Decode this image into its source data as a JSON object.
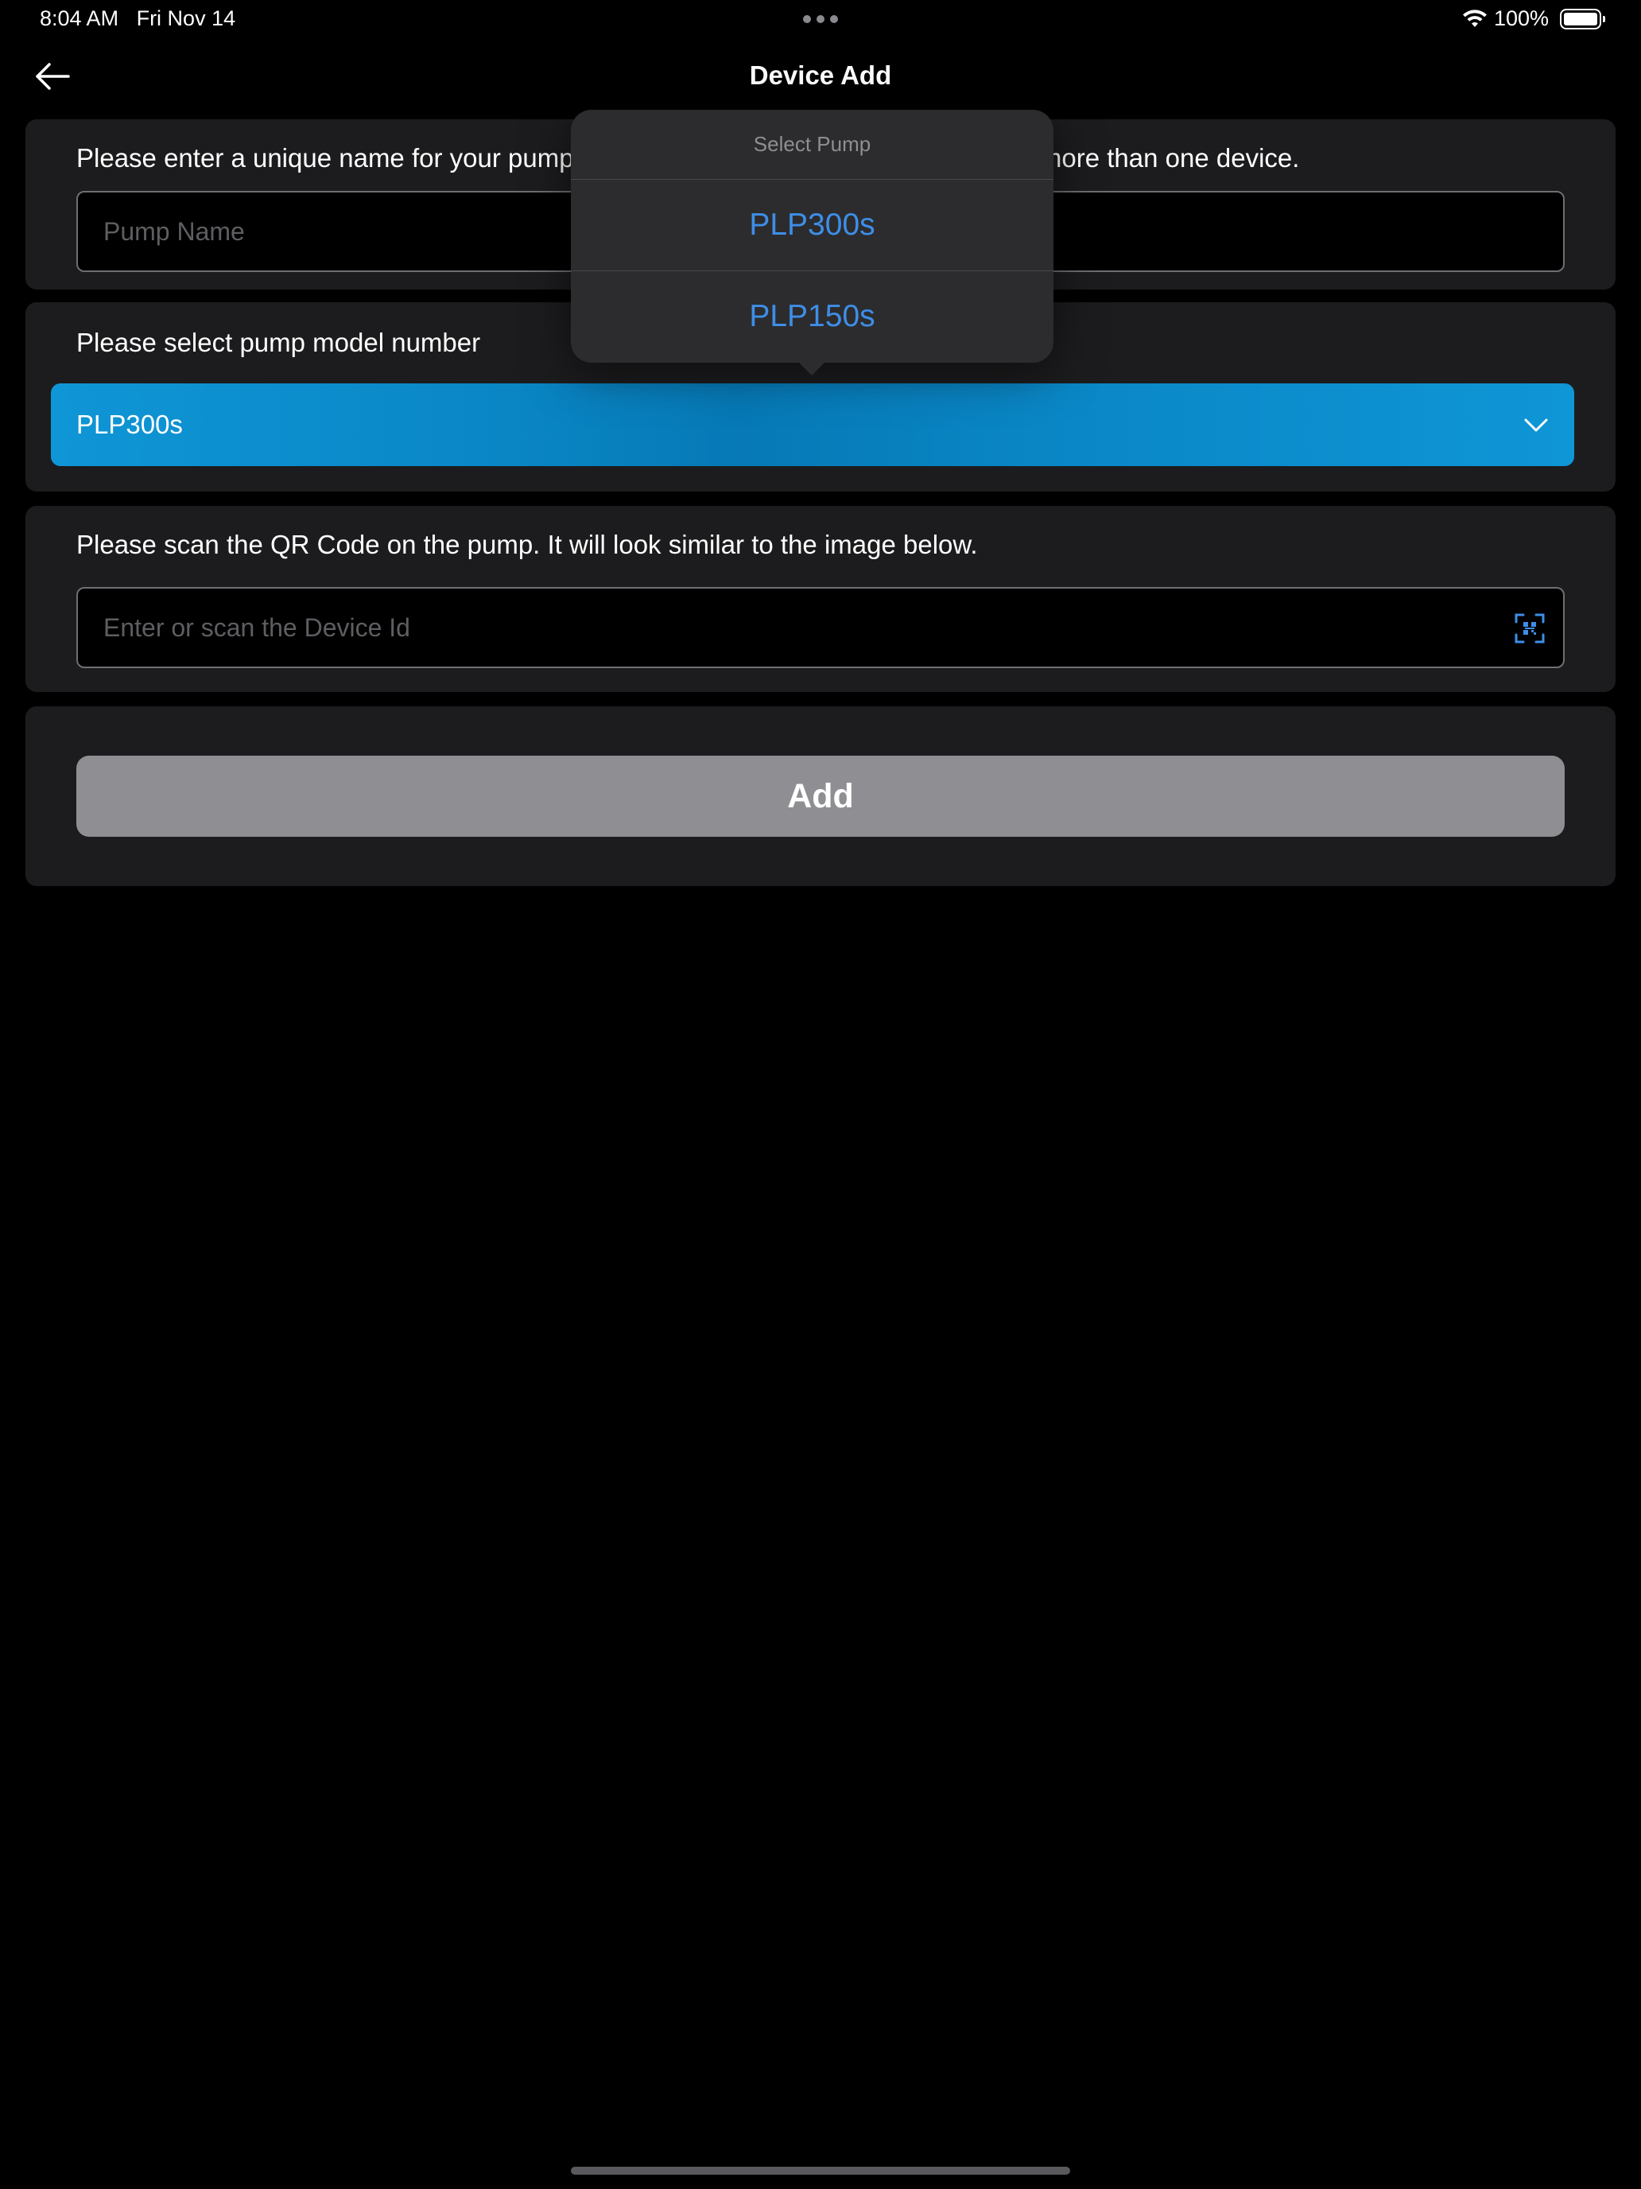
{
  "status_bar": {
    "time": "8:04 AM",
    "date": "Fri Nov 14",
    "battery": "100%",
    "icons": [
      "wifi-icon",
      "battery-icon",
      "more-dots-icon"
    ]
  },
  "nav": {
    "title": "Device Add",
    "back_icon": "arrow-left-icon"
  },
  "name_section": {
    "label": "Please enter a unique name for your pump. This will help you identify it if you have more than one device.",
    "placeholder": "Pump Name",
    "value": ""
  },
  "model_section": {
    "label": "Please select pump model number",
    "selected": "PLP300s",
    "chevron_icon": "chevron-down-icon",
    "accent_color": "#0a86c5"
  },
  "qr_section": {
    "label": "Please scan the QR Code on the pump. It will look similar to the image below.",
    "placeholder": "Enter or scan the Device Id",
    "value": "",
    "scan_icon": "qr-scan-icon"
  },
  "actions": {
    "add_label": "Add",
    "add_color": "#8e8e93"
  },
  "popover": {
    "title": "Select Pump",
    "options": [
      "PLP300s",
      "PLP150s"
    ],
    "option_color": "#3e8ee8"
  }
}
